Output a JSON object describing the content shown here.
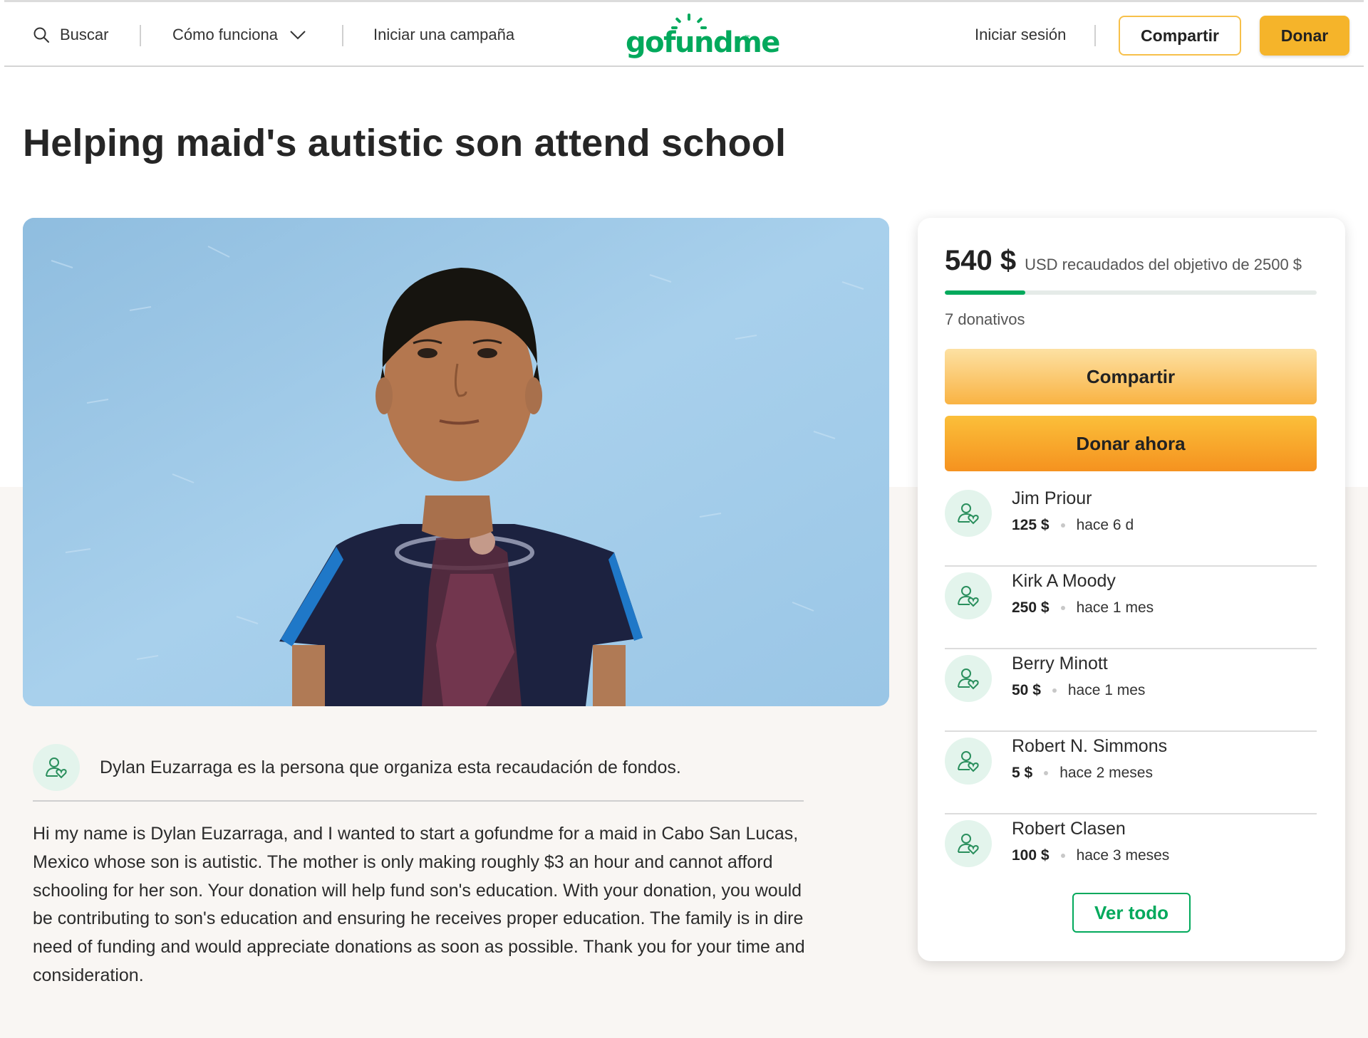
{
  "header": {
    "search_label": "Buscar",
    "how_it_works_label": "Cómo funciona",
    "start_campaign_label": "Iniciar una campaña",
    "logo_text": "gofundme",
    "login_label": "Iniciar sesión",
    "share_label": "Compartir",
    "donate_label": "Donar"
  },
  "campaign": {
    "title": "Helping maid's autistic son attend school",
    "hero_image_alt": "Boy in navy t-shirt against a light blue wall",
    "organizer_text": "Dylan Euzarraga es la persona que organiza esta recaudación de fondos.",
    "story": "Hi my name is Dylan Euzarraga, and I wanted to start a gofundme for a maid in Cabo San Lucas, Mexico whose son is autistic. The mother is only making roughly $3 an hour and cannot afford schooling for her son. Your donation will help fund son's education. With your donation, you would be contributing to son's education and ensuring he receives proper education. The family is in dire need of funding and would appreciate donations as soon as possible. Thank you for your time and consideration."
  },
  "donation_card": {
    "raised_amount": "540 $",
    "raised_label": "USD recaudados del objetivo de 2500 $",
    "progress_fraction": 0.216,
    "donation_count": "7 donativos",
    "share_button": "Compartir",
    "donate_button": "Donar ahora",
    "see_all_button": "Ver todo",
    "donors": [
      {
        "name": "Jim Priour",
        "amount": "125 $",
        "time": "hace 6 d"
      },
      {
        "name": "Kirk A Moody",
        "amount": "250 $",
        "time": "hace 1 mes"
      },
      {
        "name": "Berry Minott",
        "amount": "50 $",
        "time": "hace 1 mes"
      },
      {
        "name": "Robert N. Simmons",
        "amount": "5 $",
        "time": "hace 2 meses"
      },
      {
        "name": "Robert Clasen",
        "amount": "100 $",
        "time": "hace 3 meses"
      }
    ]
  },
  "colors": {
    "brand_green": "#02a95c",
    "accent_yellow": "#f5b42a",
    "donate_orange": "#f5921f"
  }
}
